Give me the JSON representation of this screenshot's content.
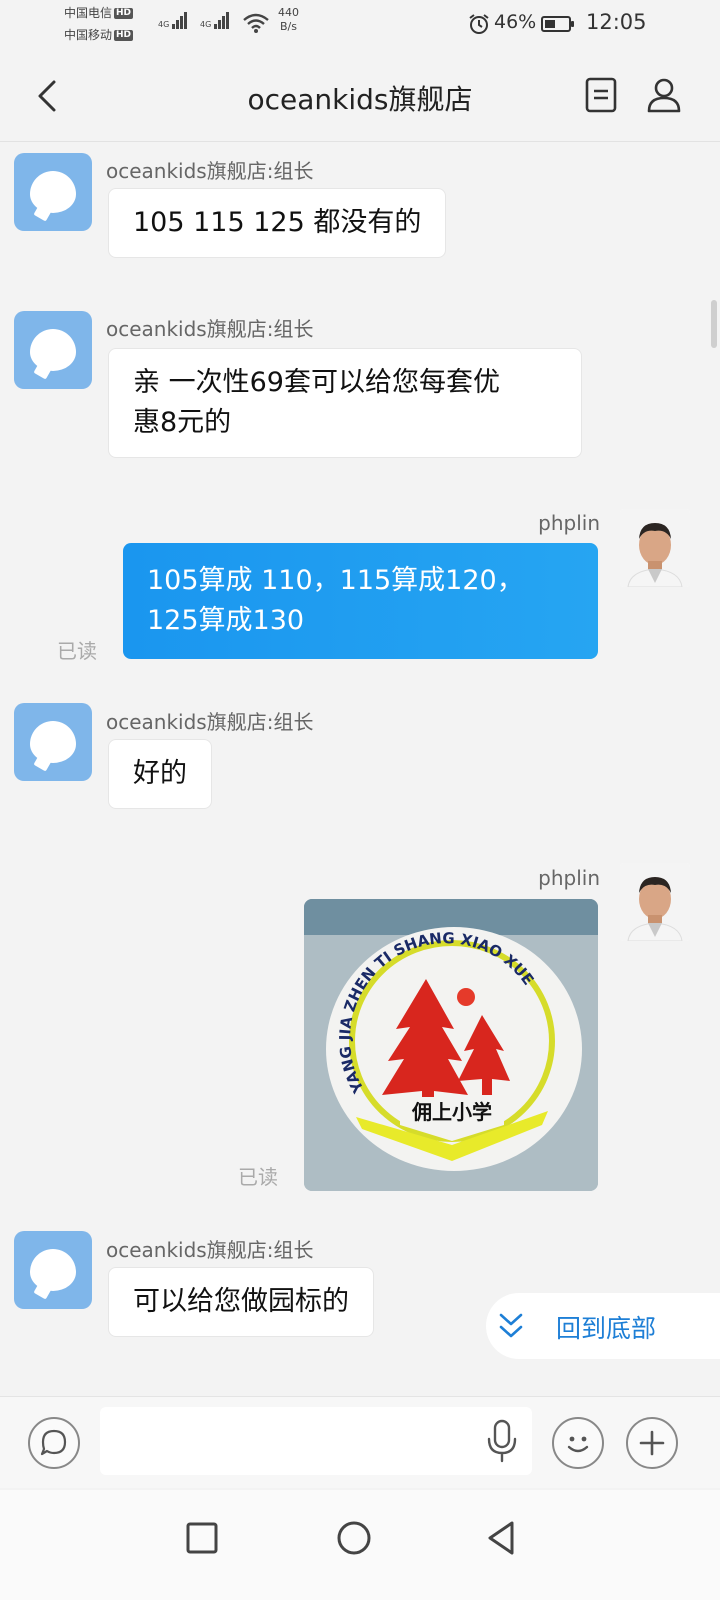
{
  "status_bar": {
    "carrier_1": "中国电信",
    "carrier_2": "中国移动",
    "hd": "HD",
    "net_1": "4G",
    "net_2": "4G",
    "speed_value": "440",
    "speed_unit": "B/s",
    "battery_percent": "46%",
    "battery_level": 0.46,
    "time": "12:05"
  },
  "header": {
    "title": "oceankids旗舰店"
  },
  "messages": [
    {
      "sender": "oceankids旗舰店:组长",
      "text": "105  115  125 都没有的"
    },
    {
      "sender": "oceankids旗舰店:组长",
      "text_line1": "亲  一次性69套可以给您每套优",
      "text_line2": "惠8元的"
    },
    {
      "sender": "phplin",
      "text_line1": "105算成 110，115算成120，",
      "text_line2": "125算成130",
      "status": "已读"
    },
    {
      "sender": "oceankids旗舰店:组长",
      "text": "好的"
    },
    {
      "sender": "phplin",
      "image_logo_text": "YANG JIA ZHEN TI SHANG XIAO XUE",
      "image_banner_text": "佣上小学",
      "status": "已读"
    },
    {
      "sender": "oceankids旗舰店:组长",
      "text": "可以给您做园标的"
    }
  ],
  "back_to_bottom": {
    "label": "回到底部"
  },
  "input_bar": {
    "placeholder": ""
  },
  "colors": {
    "outgoing_bubble": "#1e9bf0",
    "link_blue": "#1e7fd6",
    "shop_avatar": "#7fb6ea"
  }
}
